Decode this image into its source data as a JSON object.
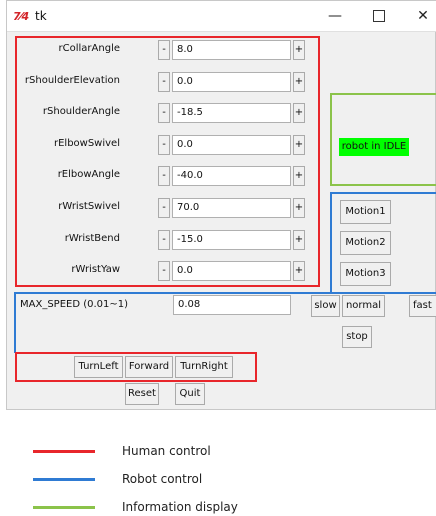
{
  "window": {
    "icon_text": "7⁄4",
    "title": "tk",
    "minimize_symbol": "—",
    "close_symbol": "✕"
  },
  "joints": [
    {
      "label": "rCollarAngle",
      "value": "8.0"
    },
    {
      "label": "rShoulderElevation",
      "value": "0.0"
    },
    {
      "label": "rShoulderAngle",
      "value": "-18.5"
    },
    {
      "label": "rElbowSwivel",
      "value": "0.0"
    },
    {
      "label": "rElbowAngle",
      "value": "-40.0"
    },
    {
      "label": "rWristSwivel",
      "value": "70.0"
    },
    {
      "label": "rWristBend",
      "value": "-15.0"
    },
    {
      "label": "rWristYaw",
      "value": "0.0"
    }
  ],
  "stepper": {
    "minus_label": "-",
    "plus_label": "+"
  },
  "status": {
    "text": "robot in IDLE",
    "color": "#00ff00"
  },
  "motions": [
    "Motion1",
    "Motion2",
    "Motion3"
  ],
  "speed": {
    "label": "MAX_SPEED (0.01~1)",
    "value": "0.08",
    "slow_label": "slow",
    "normal_label": "normal",
    "fast_label": "fast",
    "stop_label": "stop"
  },
  "navigation": {
    "turn_left_label": "TurnLeft",
    "forward_label": "Forward",
    "turn_right_label": "TurnRight"
  },
  "actions": {
    "reset_label": "Reset",
    "quit_label": "Quit"
  },
  "legend": [
    {
      "label": "Human control",
      "color": "#e8262b"
    },
    {
      "label": "Robot control",
      "color": "#2f7bd3"
    },
    {
      "label": "Information display",
      "color": "#8bc34a"
    }
  ]
}
